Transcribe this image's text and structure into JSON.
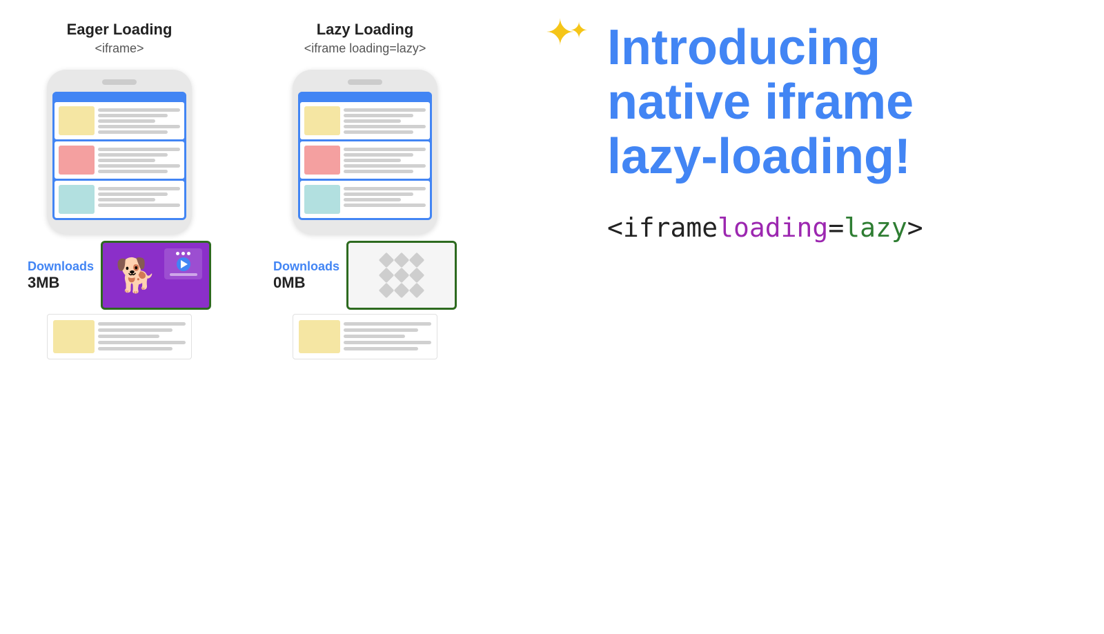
{
  "eager": {
    "title": "Eager Loading",
    "subtitle": "<iframe>",
    "downloads_label": "Downloads",
    "downloads_size": "3MB"
  },
  "lazy": {
    "title": "Lazy Loading",
    "subtitle": "<iframe loading=lazy>",
    "downloads_label": "Downloads",
    "downloads_size": "0MB"
  },
  "heading_line1": "Introducing",
  "heading_line2": "native iframe",
  "heading_line3": "lazy-loading!",
  "code_part1": "<iframe ",
  "code_part2": "loading",
  "code_part3": "=",
  "code_part4": "lazy",
  "code_part5": ">"
}
